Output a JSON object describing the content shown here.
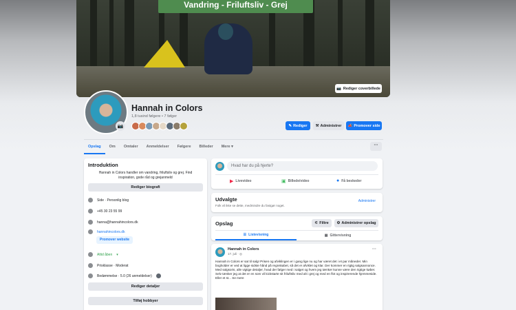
{
  "cover": {
    "banner": "Vandring - Friluftsliv - Grej",
    "edit_cover": "Rediger coverbillede"
  },
  "profile": {
    "name": "Hannah in Colors",
    "followers": "1,8 tusind følgere • 7 følger"
  },
  "actions": {
    "edit": "Rediger",
    "admin": "Administrer",
    "promote": "Promover side"
  },
  "tabs": [
    "Opslag",
    "Om",
    "Omtaler",
    "Anmeldelser",
    "Følgere",
    "Billeder",
    "Mere"
  ],
  "intro": {
    "title": "Introduktion",
    "bio": "Hannah in Colors handler om vandring, friluftsliv og grej. Find inspiration, gode råd og grejanmeld",
    "edit_bio": "Rediger biografi",
    "page_type": "Side · Personlig blog",
    "phone": "+45 30 23 55 99",
    "email": "hanna@hannahincolors.dk",
    "website": "hannahincolors.dk",
    "promote_website": "Promover website",
    "open": "Altid åben",
    "price": "Prisklasse · Moderat",
    "rating": "Bedømmelse · 5.0 (26 anmeldelser)",
    "edit_details": "Rediger detaljer",
    "add_hobbies": "Tilføj hobbyer"
  },
  "composer": {
    "placeholder": "Hvad har du på hjerte?",
    "live": "Livevideo",
    "photo": "Billede/video",
    "messages": "Få beskeder"
  },
  "featured": {
    "title": "Udvalgte",
    "text": "Folk vil ikke se dette, medmindre du fastgør noget.",
    "manage": "Administrer"
  },
  "posts": {
    "title": "Opslag",
    "filter": "Filtre",
    "manage": "Administrer opslag",
    "list_view": "Listevisning",
    "grid_view": "Gittervisning"
  },
  "post": {
    "author": "Hannah in Colors",
    "date": "17. juli · ◎",
    "text": "Hannah in Colors er sat til salg! Prisen og afviklingen er i gang lige nu og har været det i et par måneder. Min bogholder er ved at ligge sidste hånd på regnskabet, så det er afviklet og klar. Der kommer en rigtig salgsannonce. Med salgsoris, alle vigtige detaljer, hvad der følger med i salget og hvem jeg tænker kunne være den rigtige køber. Selv tænker jeg at det er en som vil kickstarte sit friluftsliv med alt i grej og med en flot og inspirerende hjemmeside. Eller et st... Se mere"
  }
}
